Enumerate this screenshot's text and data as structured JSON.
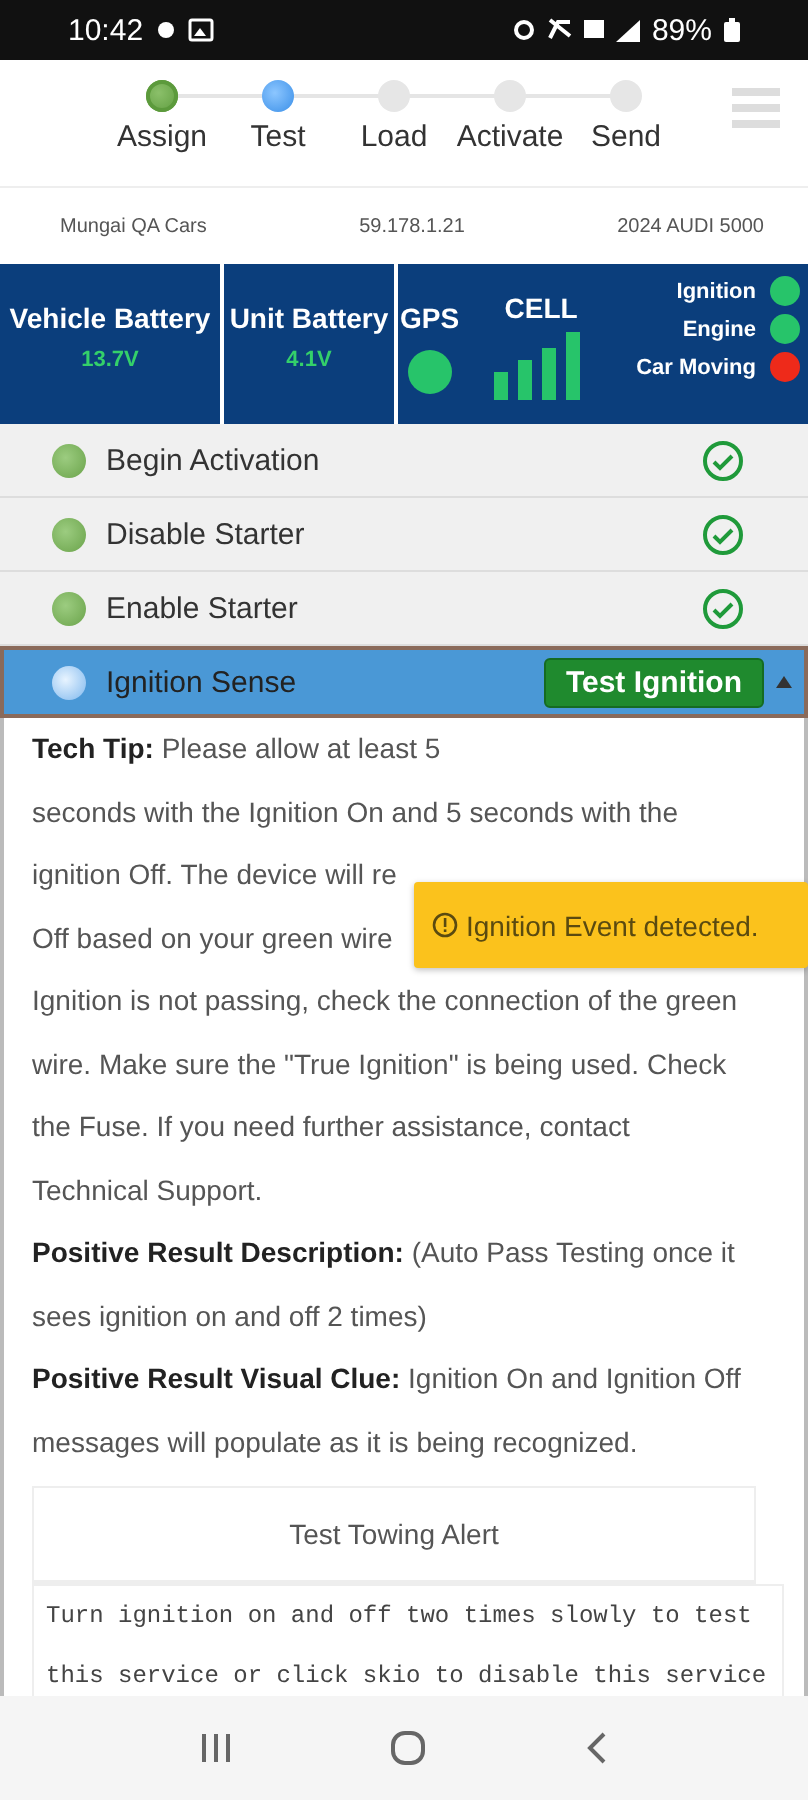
{
  "status_bar": {
    "time": "10:42",
    "battery": "89%"
  },
  "steps": [
    {
      "label": "Assign",
      "done": true,
      "selected": false
    },
    {
      "label": "Test",
      "done": false,
      "selected": true
    },
    {
      "label": "Load",
      "done": false,
      "selected": false
    },
    {
      "label": "Activate",
      "done": false,
      "selected": false
    },
    {
      "label": "Send",
      "done": false,
      "selected": false
    }
  ],
  "info": [
    "Mungai QA Cars",
    "59.178.1.21",
    "2024 AUDI 5000"
  ],
  "dashboard": {
    "vehicle_battery": {
      "label": "Vehicle Battery",
      "value": "13.7V"
    },
    "unit_battery": {
      "label": "Unit Battery",
      "value": "4.1V"
    },
    "gps": {
      "label": "GPS",
      "color": "#27c46a"
    },
    "cell": {
      "label": "CELL"
    },
    "indicators": [
      {
        "label": "Ignition",
        "color": "#27c46a"
      },
      {
        "label": "Engine",
        "color": "#27c46a"
      },
      {
        "label": "Car Moving",
        "color": "#ee2a1a"
      }
    ]
  },
  "tests": [
    {
      "name": "Begin Activation",
      "passed": true,
      "selected": false
    },
    {
      "name": "Disable Starter",
      "passed": true,
      "selected": false
    },
    {
      "name": "Enable Starter",
      "passed": true,
      "selected": false
    },
    {
      "name": "Ignition Sense",
      "passed": false,
      "selected": true,
      "button": "Test Ignition",
      "expanded": true
    }
  ],
  "tip": {
    "label": "Tech Tip:",
    "lines": [
      "Please allow at least 5",
      "seconds with the Ignition On and 5 seconds with the",
      "ignition Off. The device will re",
      "Off based on your green wire",
      "Ignition is not passing, check the connection of the green",
      "wire. Make sure the \"True Ignition\" is being used. Check",
      "the Fuse. If you need further assistance, contact",
      "Technical Support."
    ]
  },
  "result_description": "**Positive Result Description:** (Auto Pass Testing once it sees ignition on and off 2 times)",
  "result_clue": "**Positive Result Visual Clue:** Ignition On and Ignition Off messages will populate as it is being recognized.",
  "alert_card": {
    "title": "Test Towing Alert",
    "message": "Turn ignition on and off two times slowly to test this service or click skio to disable this service"
  },
  "toast": {
    "message": "Ignition Event detected."
  }
}
